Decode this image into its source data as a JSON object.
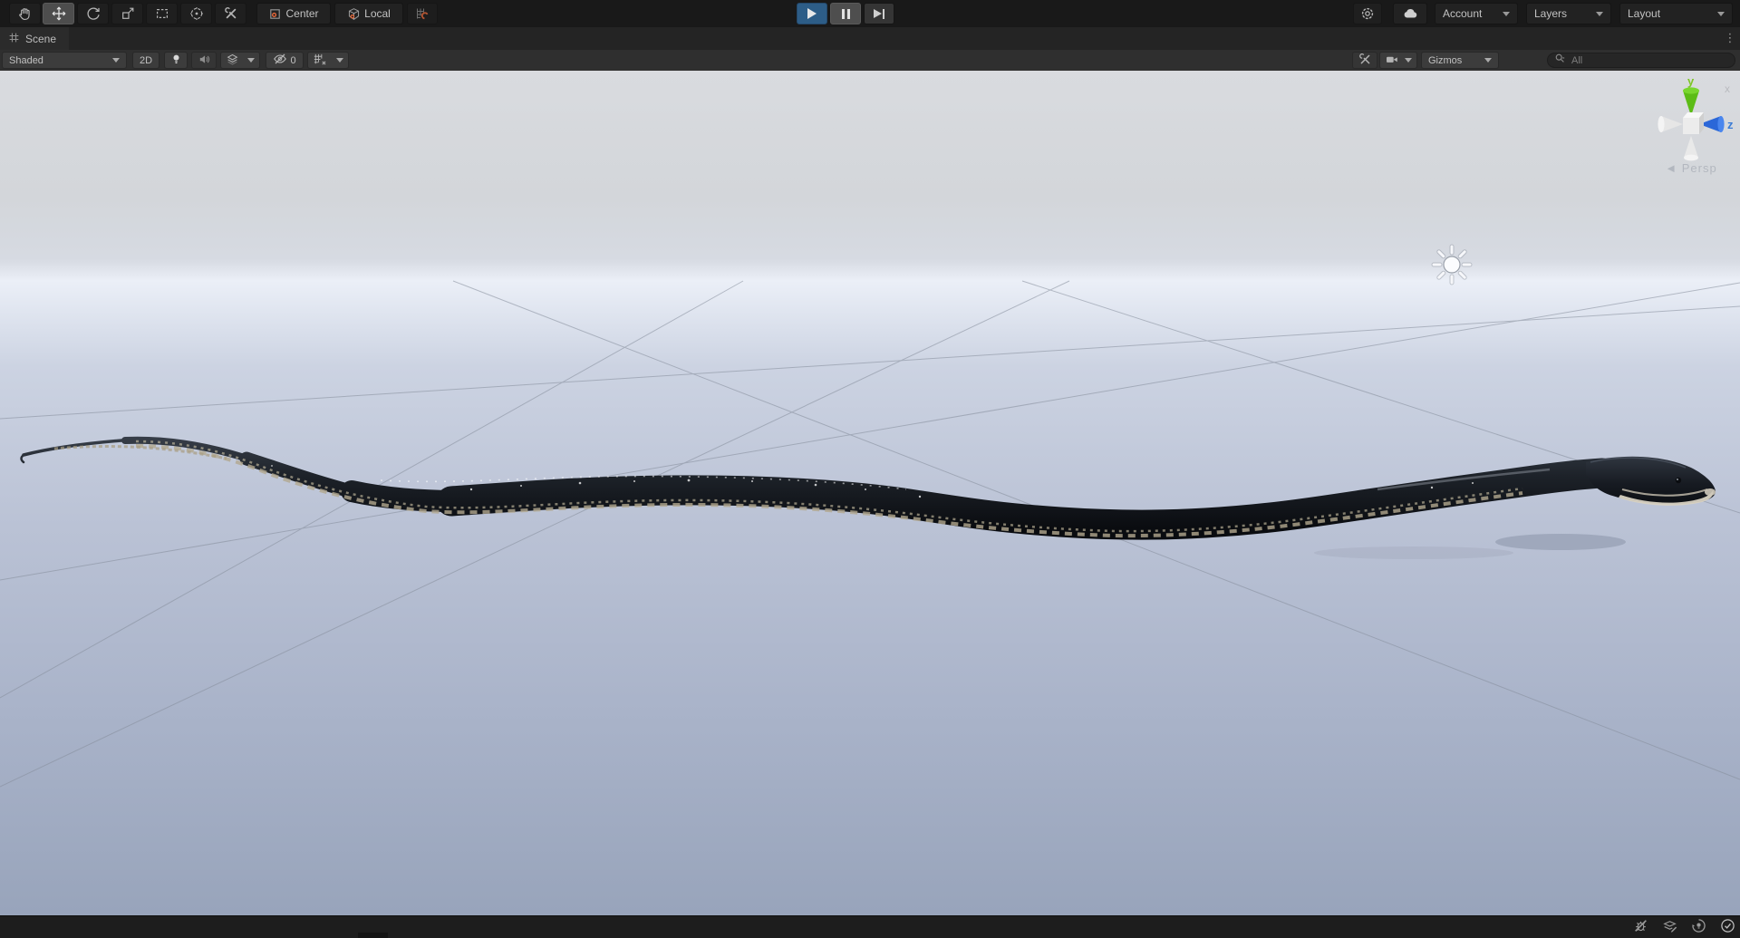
{
  "colors": {
    "accent-orange": "#e8683a",
    "play-active": "#2d5d87",
    "axis-y": "#7ec625",
    "axis-z": "#3a7bd5",
    "sky-top": "#d9dbdf",
    "horizon-glow": "#ebeff7",
    "ground-bottom": "#98a4bb"
  },
  "topbar": {
    "pivot_label": "Center",
    "rotation_label": "Local",
    "account_label": "Account",
    "layers_label": "Layers",
    "layout_label": "Layout"
  },
  "scene_tab": {
    "label": "Scene",
    "more_icon": "⋮"
  },
  "scene_toolbar": {
    "shading_mode": "Shaded",
    "mode_2d_label": "2D",
    "hidden_count": "0",
    "gizmos_label": "Gizmos",
    "search_placeholder": "All"
  },
  "viewport": {
    "axis_y_label": "y",
    "axis_z_label": "z",
    "axis_x_label": "x",
    "projection_arrow": "◄",
    "projection_label": "Persp"
  }
}
